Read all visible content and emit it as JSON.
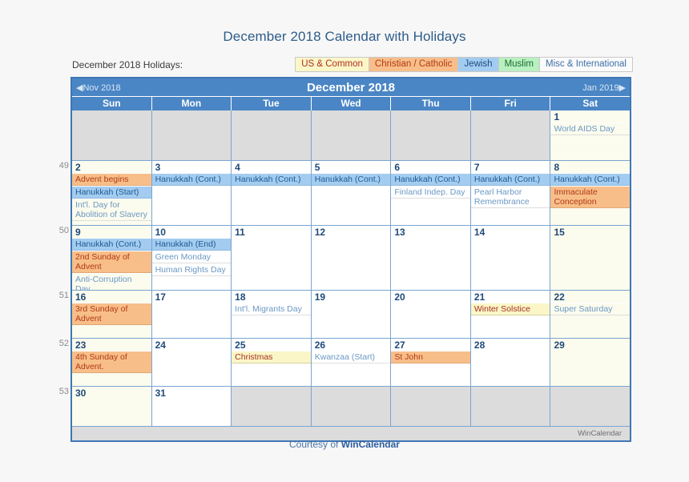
{
  "page": {
    "title": "December 2018 Calendar with Holidays",
    "background_color": "#f7f7f7",
    "accent_color": "#4a86c5"
  },
  "legend": {
    "label": "December 2018 Holidays:",
    "categories": [
      {
        "id": "us",
        "label": "US & Common",
        "bg": "#faf6c8",
        "fg": "#b03020"
      },
      {
        "id": "christ",
        "label": "Christian / Catholic",
        "bg": "#f8be8a",
        "fg": "#b03a14"
      },
      {
        "id": "jewish",
        "label": "Jewish",
        "bg": "#a3ccf0",
        "fg": "#1d4e80"
      },
      {
        "id": "muslim",
        "label": "Muslim",
        "bg": "#b8f0c0",
        "fg": "#1b6b2e"
      },
      {
        "id": "misc",
        "label": "Misc & International",
        "bg": "#fbfbfb",
        "fg": "#3d6ea5"
      }
    ]
  },
  "calendar": {
    "month_title": "December 2018",
    "prev_label": "Nov 2018",
    "next_label": "Jan 2019",
    "prev_arrow": "◀",
    "next_arrow": "▶",
    "weekday_headers": [
      "Sun",
      "Mon",
      "Tue",
      "Wed",
      "Thu",
      "Fri",
      "Sat"
    ],
    "watermark": "WinCalendar",
    "weeks": [
      {
        "week_number": "",
        "days": [
          {
            "num": "",
            "blank": true,
            "weekend": false,
            "events": []
          },
          {
            "num": "",
            "blank": true,
            "weekend": false,
            "events": []
          },
          {
            "num": "",
            "blank": true,
            "weekend": false,
            "events": []
          },
          {
            "num": "",
            "blank": true,
            "weekend": false,
            "events": []
          },
          {
            "num": "",
            "blank": true,
            "weekend": false,
            "events": []
          },
          {
            "num": "",
            "blank": true,
            "weekend": false,
            "events": []
          },
          {
            "num": "1",
            "blank": false,
            "weekend": true,
            "events": [
              {
                "text": "World AIDS Day",
                "cat": "misc"
              }
            ]
          }
        ]
      },
      {
        "week_number": "49",
        "days": [
          {
            "num": "2",
            "blank": false,
            "weekend": true,
            "events": [
              {
                "text": "Advent begins",
                "cat": "christ"
              },
              {
                "text": "Hanukkah (Start)",
                "cat": "jewish"
              },
              {
                "text": "Int'l. Day for Abolition of Slavery",
                "cat": "misc"
              }
            ]
          },
          {
            "num": "3",
            "blank": false,
            "weekend": false,
            "events": [
              {
                "text": "Hanukkah (Cont.)",
                "cat": "jewish"
              }
            ]
          },
          {
            "num": "4",
            "blank": false,
            "weekend": false,
            "events": [
              {
                "text": "Hanukkah (Cont.)",
                "cat": "jewish"
              }
            ]
          },
          {
            "num": "5",
            "blank": false,
            "weekend": false,
            "events": [
              {
                "text": "Hanukkah (Cont.)",
                "cat": "jewish"
              }
            ]
          },
          {
            "num": "6",
            "blank": false,
            "weekend": false,
            "events": [
              {
                "text": "Hanukkah (Cont.)",
                "cat": "jewish"
              },
              {
                "text": "Finland Indep. Day",
                "cat": "misc"
              }
            ]
          },
          {
            "num": "7",
            "blank": false,
            "weekend": false,
            "events": [
              {
                "text": "Hanukkah (Cont.)",
                "cat": "jewish"
              },
              {
                "text": "Pearl Harbor Remembrance",
                "cat": "misc"
              }
            ]
          },
          {
            "num": "8",
            "blank": false,
            "weekend": true,
            "events": [
              {
                "text": "Hanukkah (Cont.)",
                "cat": "jewish"
              },
              {
                "text": "Immaculate Conception",
                "cat": "christ"
              }
            ]
          }
        ]
      },
      {
        "week_number": "50",
        "days": [
          {
            "num": "9",
            "blank": false,
            "weekend": true,
            "events": [
              {
                "text": "Hanukkah (Cont.)",
                "cat": "jewish"
              },
              {
                "text": "2nd Sunday of Advent",
                "cat": "christ"
              },
              {
                "text": "Anti-Corruption Day",
                "cat": "misc"
              }
            ]
          },
          {
            "num": "10",
            "blank": false,
            "weekend": false,
            "events": [
              {
                "text": "Hanukkah (End)",
                "cat": "jewish"
              },
              {
                "text": "Green Monday",
                "cat": "misc"
              },
              {
                "text": "Human Rights Day",
                "cat": "misc"
              }
            ]
          },
          {
            "num": "11",
            "blank": false,
            "weekend": false,
            "events": []
          },
          {
            "num": "12",
            "blank": false,
            "weekend": false,
            "events": []
          },
          {
            "num": "13",
            "blank": false,
            "weekend": false,
            "events": []
          },
          {
            "num": "14",
            "blank": false,
            "weekend": false,
            "events": []
          },
          {
            "num": "15",
            "blank": false,
            "weekend": true,
            "events": []
          }
        ]
      },
      {
        "week_number": "51",
        "days": [
          {
            "num": "16",
            "blank": false,
            "weekend": true,
            "events": [
              {
                "text": "3rd Sunday of Advent",
                "cat": "christ"
              }
            ]
          },
          {
            "num": "17",
            "blank": false,
            "weekend": false,
            "events": []
          },
          {
            "num": "18",
            "blank": false,
            "weekend": false,
            "events": [
              {
                "text": "Int'l. Migrants Day",
                "cat": "misc"
              }
            ]
          },
          {
            "num": "19",
            "blank": false,
            "weekend": false,
            "events": []
          },
          {
            "num": "20",
            "blank": false,
            "weekend": false,
            "events": []
          },
          {
            "num": "21",
            "blank": false,
            "weekend": false,
            "events": [
              {
                "text": "Winter Solstice",
                "cat": "us"
              }
            ]
          },
          {
            "num": "22",
            "blank": false,
            "weekend": true,
            "events": [
              {
                "text": "Super Saturday",
                "cat": "misc"
              }
            ]
          }
        ]
      },
      {
        "week_number": "52",
        "days": [
          {
            "num": "23",
            "blank": false,
            "weekend": true,
            "events": [
              {
                "text": "4th Sunday of Advent.",
                "cat": "christ"
              }
            ]
          },
          {
            "num": "24",
            "blank": false,
            "weekend": false,
            "events": []
          },
          {
            "num": "25",
            "blank": false,
            "weekend": false,
            "events": [
              {
                "text": "Christmas",
                "cat": "us"
              }
            ]
          },
          {
            "num": "26",
            "blank": false,
            "weekend": false,
            "events": [
              {
                "text": "Kwanzaa (Start)",
                "cat": "misc"
              }
            ]
          },
          {
            "num": "27",
            "blank": false,
            "weekend": false,
            "events": [
              {
                "text": "St John",
                "cat": "christ"
              }
            ]
          },
          {
            "num": "28",
            "blank": false,
            "weekend": false,
            "events": []
          },
          {
            "num": "29",
            "blank": false,
            "weekend": true,
            "events": []
          }
        ]
      },
      {
        "week_number": "53",
        "days": [
          {
            "num": "30",
            "blank": false,
            "weekend": true,
            "events": []
          },
          {
            "num": "31",
            "blank": false,
            "weekend": false,
            "events": []
          },
          {
            "num": "",
            "blank": true,
            "weekend": false,
            "events": []
          },
          {
            "num": "",
            "blank": true,
            "weekend": false,
            "events": []
          },
          {
            "num": "",
            "blank": true,
            "weekend": false,
            "events": []
          },
          {
            "num": "",
            "blank": true,
            "weekend": false,
            "events": []
          },
          {
            "num": "",
            "blank": true,
            "weekend": false,
            "events": []
          }
        ]
      }
    ]
  },
  "footer": {
    "prefix": "Courtesy of ",
    "brand": "WinCalendar"
  }
}
